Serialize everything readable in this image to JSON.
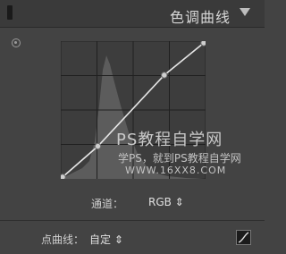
{
  "header": {
    "title": "色调曲线"
  },
  "curve": {
    "points": [
      [
        0,
        0
      ],
      [
        0.25,
        0.23
      ],
      [
        0.72,
        0.76
      ],
      [
        1,
        1
      ]
    ],
    "histogram_color": "#5c5c5c",
    "curve_color": "#e6e6e6"
  },
  "watermark": {
    "main": "PS教程自学网",
    "sub": "学PS，就到PS教程自学网",
    "url": "WWW.16XX8.COM"
  },
  "channel": {
    "label": "通道：",
    "value": "RGB ⇕"
  },
  "point_curve": {
    "label": "点曲线：",
    "value": "自定 ⇕"
  }
}
